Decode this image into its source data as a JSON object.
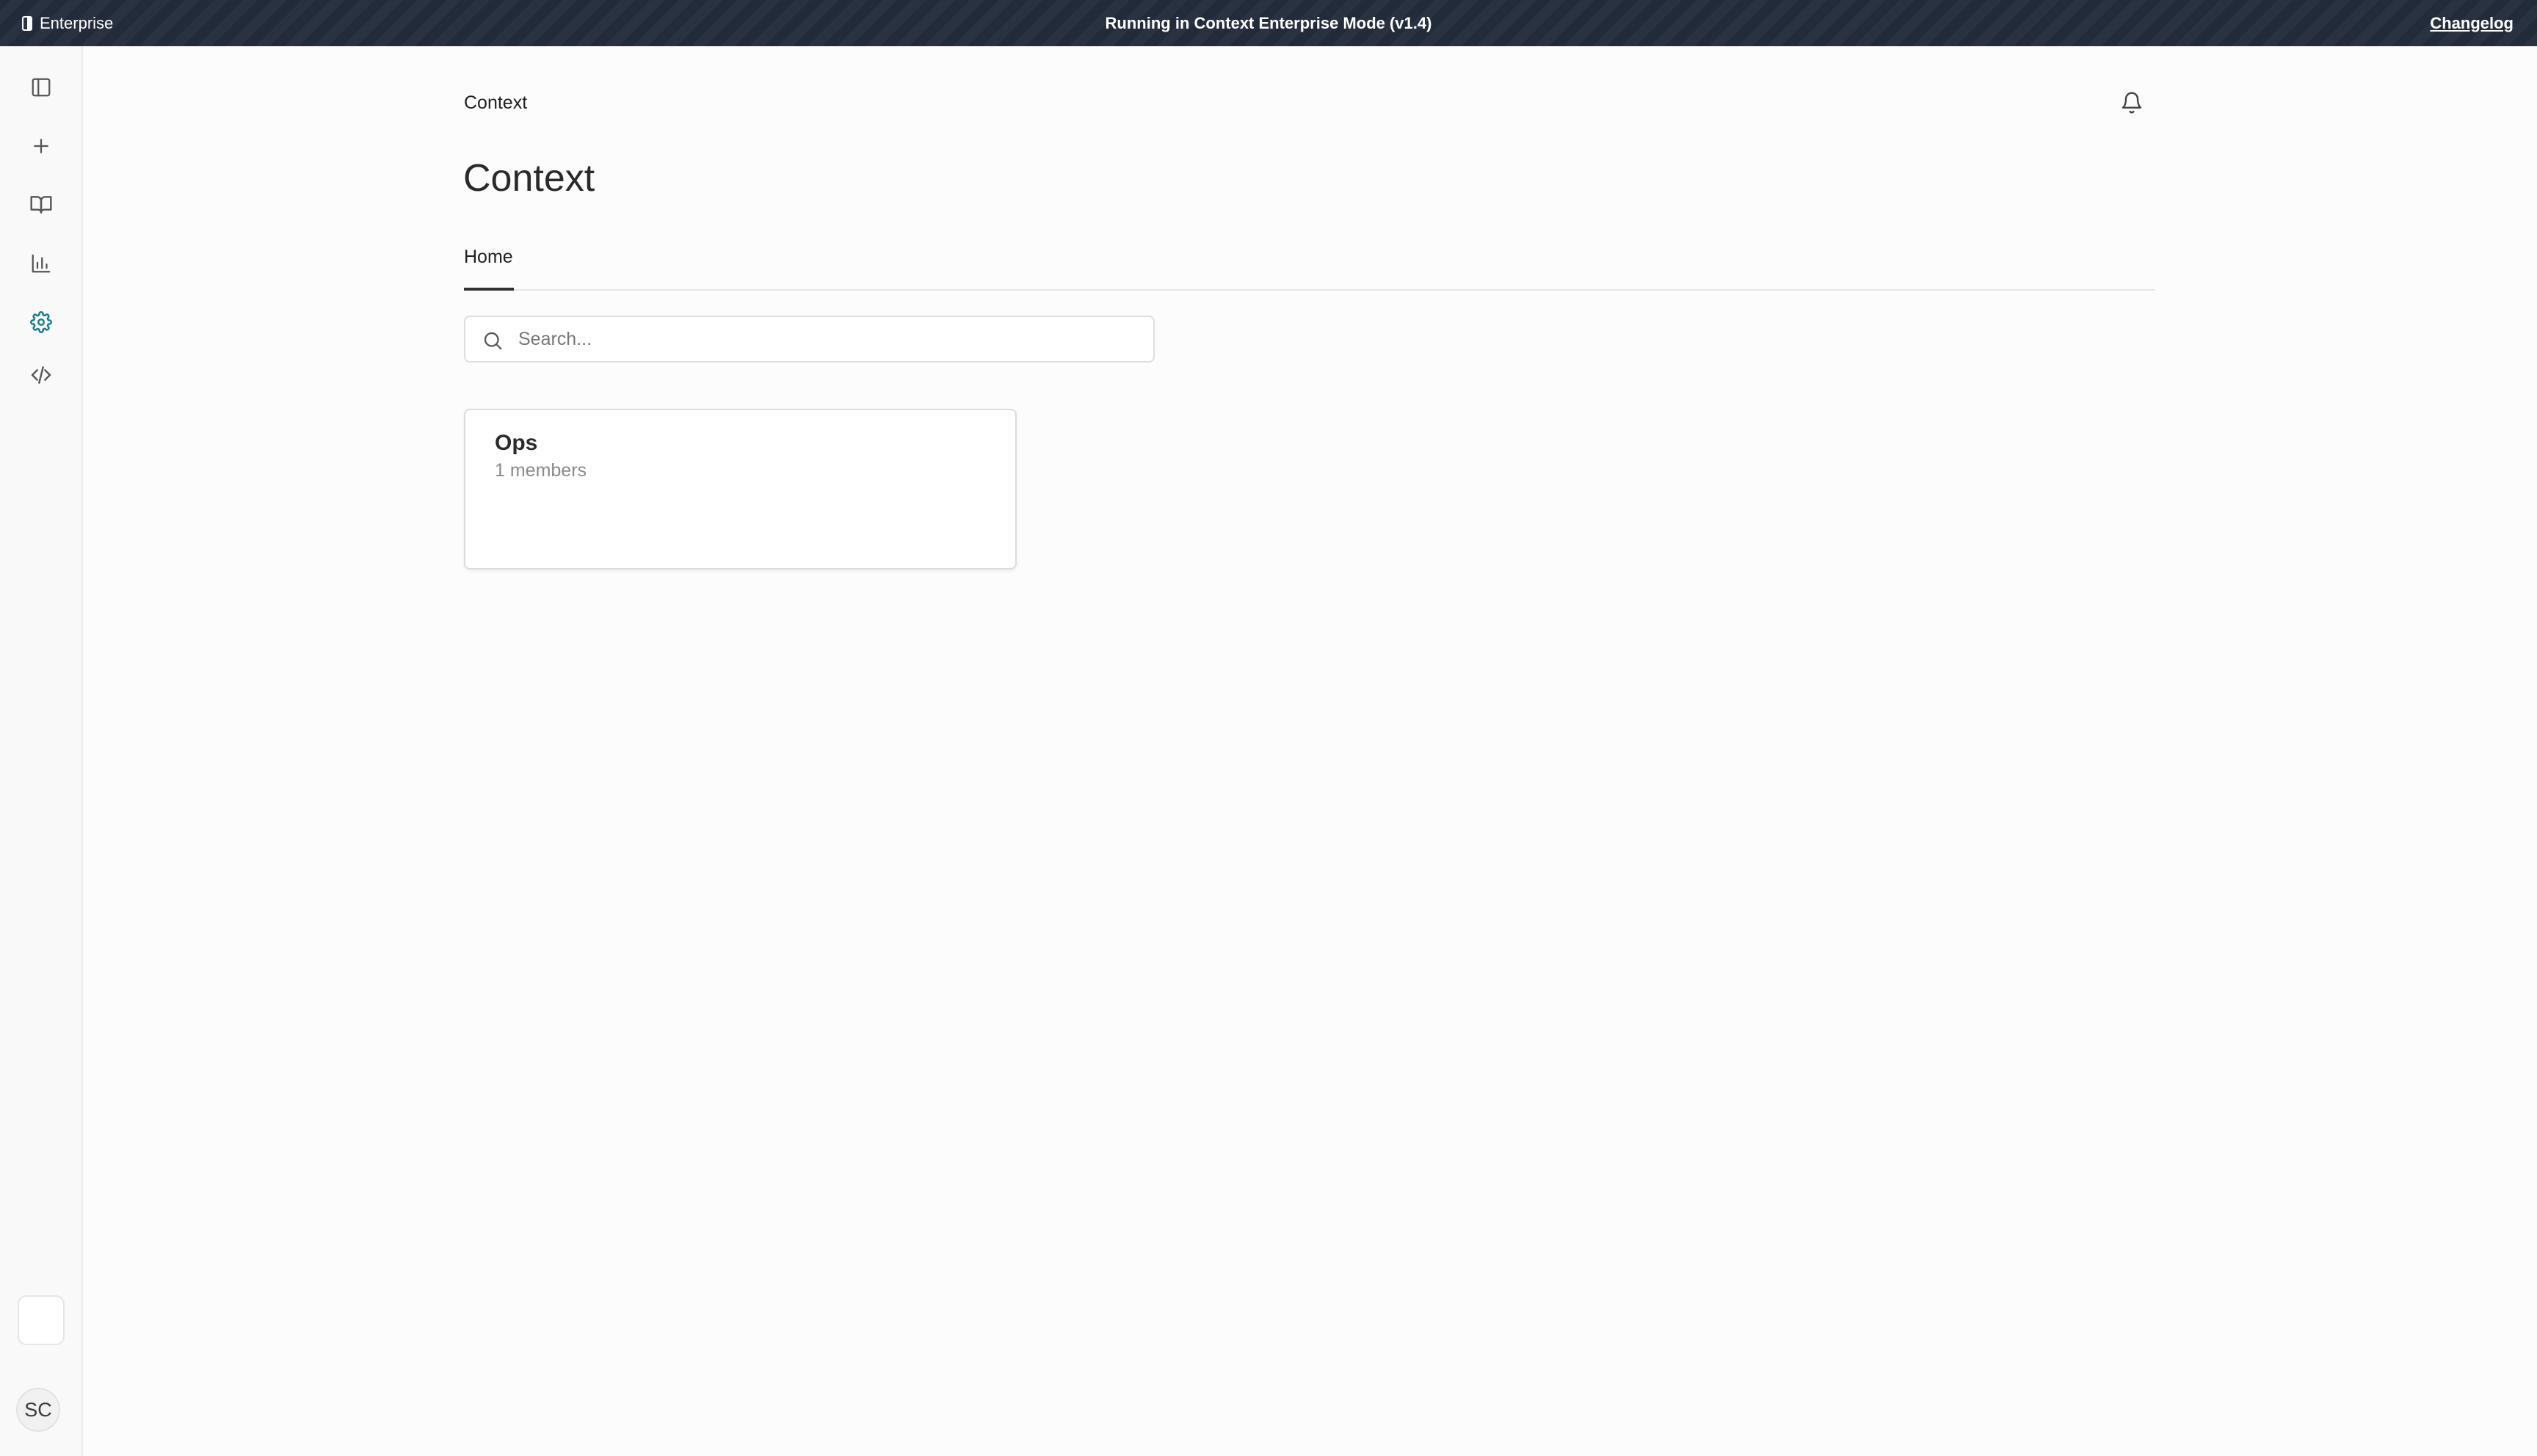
{
  "banner": {
    "brand_label": "Enterprise",
    "message": "Running in Context Enterprise Mode (v1.4)",
    "changelog_link": "Changelog"
  },
  "sidebar": {
    "items": [
      {
        "name": "toggle-sidebar",
        "icon": "panel-left-icon"
      },
      {
        "name": "new",
        "icon": "plus-icon"
      },
      {
        "name": "library",
        "icon": "book-open-icon"
      },
      {
        "name": "analytics",
        "icon": "bar-chart-icon"
      },
      {
        "name": "settings",
        "icon": "gear-icon",
        "active": true
      },
      {
        "name": "developer",
        "icon": "code-icon"
      }
    ],
    "active_color": "#1b7a8c",
    "icon_color": "#555555",
    "avatar_initials": "SC"
  },
  "header": {
    "breadcrumb": "Context",
    "title": "Context"
  },
  "tabs": [
    {
      "label": "Home",
      "active": true
    }
  ],
  "search": {
    "placeholder": "Search...",
    "value": ""
  },
  "groups": [
    {
      "name": "Ops",
      "members": "1 members"
    }
  ]
}
